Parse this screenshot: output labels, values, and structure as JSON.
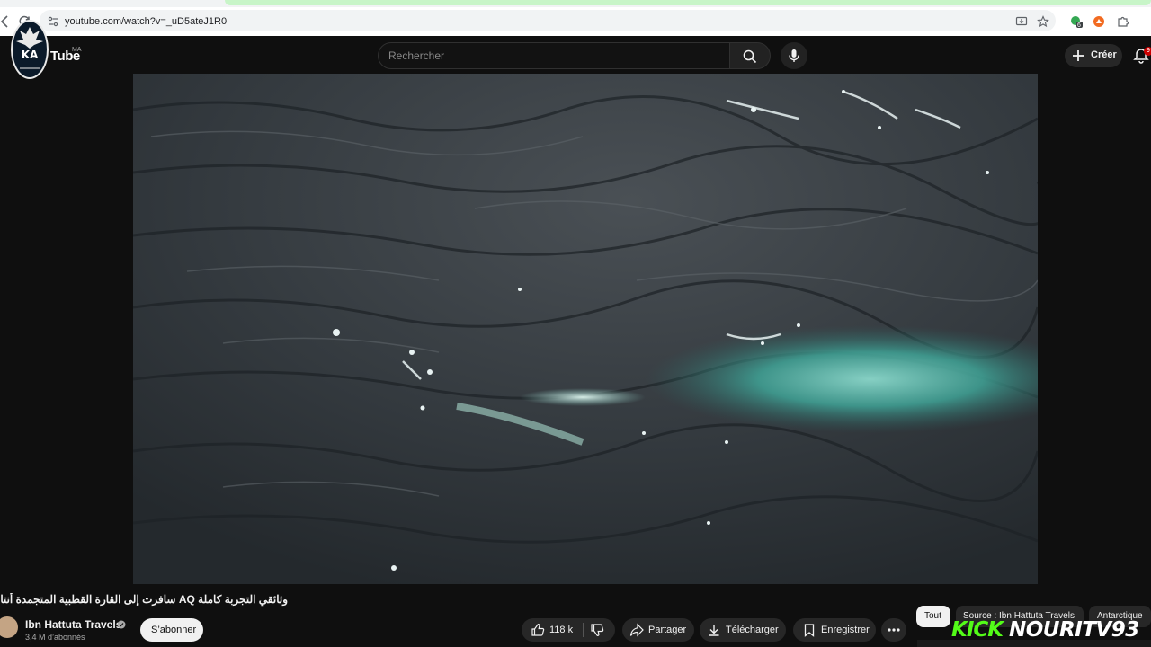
{
  "browser": {
    "url": "youtube.com/watch?v=_uD5ateJ1R0",
    "extensions_badge": "6"
  },
  "channel_logo": {
    "text": "KA"
  },
  "youtube": {
    "wordmark": "Tube",
    "country_code": "MA",
    "search_placeholder": "Rechercher",
    "create_label": "Créer",
    "notifications_count": "9"
  },
  "video": {
    "title": "وثائقي التجربة كاملة AQ سافرت إلى القارة القطبية المتجمدة أنتاركتيكا"
  },
  "owner": {
    "name": "Ibn Hattuta Travels",
    "subscribers": "3,4 M d’abonnés",
    "subscribe_label": "S’abonner"
  },
  "actions": {
    "likes": "118 k",
    "share": "Partager",
    "download": "Télécharger",
    "save": "Enregistrer"
  },
  "chips": [
    {
      "label": "Tout",
      "active": true
    },
    {
      "label": "Source : Ibn Hattuta Travels",
      "active": false
    },
    {
      "label": "Antarctique",
      "active": false
    }
  ],
  "overlay": {
    "kick_brand": "KICK",
    "kick_handle": "NOURITV93"
  },
  "colors": {
    "page_bg": "#0f0f0f",
    "kick_green": "#53fc18",
    "bell_badge": "#cc0000"
  }
}
